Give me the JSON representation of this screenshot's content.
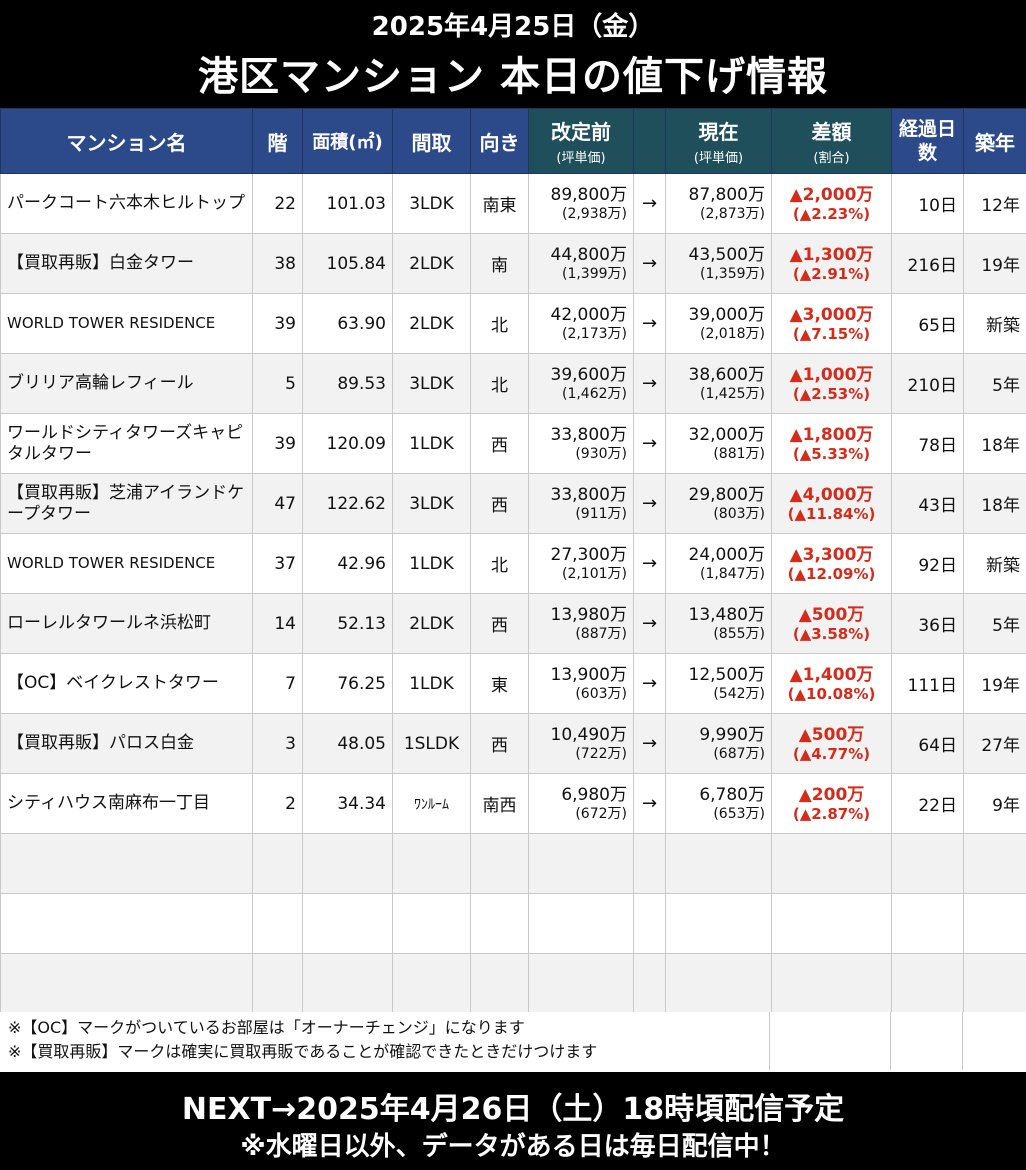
{
  "header": {
    "date": "2025年4月25日（金）",
    "title": "港区マンション 本日の値下げ情報"
  },
  "columns": {
    "name": "マンション名",
    "floor": "階",
    "area": "面積(㎡)",
    "layout": "間取",
    "direction": "向き",
    "before": "改定前",
    "before_sub": "(坪単価)",
    "current": "現在",
    "current_sub": "(坪単価)",
    "diff": "差額",
    "diff_sub": "(割合)",
    "elapsed": "経過日数",
    "age": "築年"
  },
  "arrow": "→",
  "rows": [
    {
      "name": "パークコート六本木ヒルトップ",
      "floor": "22",
      "area": "101.03",
      "layout": "3LDK",
      "direction": "南東",
      "before": "89,800万",
      "before_tsubo": "(2,938万)",
      "current": "87,800万",
      "current_tsubo": "(2,873万)",
      "diff": "▲2,000万",
      "diff_pct": "(▲2.23%)",
      "elapsed": "10日",
      "age": "12年"
    },
    {
      "name": "【買取再販】白金タワー",
      "floor": "38",
      "area": "105.84",
      "layout": "2LDK",
      "direction": "南",
      "before": "44,800万",
      "before_tsubo": "(1,399万)",
      "current": "43,500万",
      "current_tsubo": "(1,359万)",
      "diff": "▲1,300万",
      "diff_pct": "(▲2.91%)",
      "elapsed": "216日",
      "age": "19年"
    },
    {
      "name": "WORLD TOWER RESIDENCE",
      "floor": "39",
      "area": "63.90",
      "layout": "2LDK",
      "direction": "北",
      "before": "42,000万",
      "before_tsubo": "(2,173万)",
      "current": "39,000万",
      "current_tsubo": "(2,018万)",
      "diff": "▲3,000万",
      "diff_pct": "(▲7.15%)",
      "elapsed": "65日",
      "age": "新築"
    },
    {
      "name": "ブリリア高輪レフィール",
      "floor": "5",
      "area": "89.53",
      "layout": "3LDK",
      "direction": "北",
      "before": "39,600万",
      "before_tsubo": "(1,462万)",
      "current": "38,600万",
      "current_tsubo": "(1,425万)",
      "diff": "▲1,000万",
      "diff_pct": "(▲2.53%)",
      "elapsed": "210日",
      "age": "5年"
    },
    {
      "name": "ワールドシティタワーズキャピタルタワー",
      "floor": "39",
      "area": "120.09",
      "layout": "1LDK",
      "direction": "西",
      "before": "33,800万",
      "before_tsubo": "(930万)",
      "current": "32,000万",
      "current_tsubo": "(881万)",
      "diff": "▲1,800万",
      "diff_pct": "(▲5.33%)",
      "elapsed": "78日",
      "age": "18年"
    },
    {
      "name": "【買取再販】芝浦アイランドケープタワー",
      "floor": "47",
      "area": "122.62",
      "layout": "3LDK",
      "direction": "西",
      "before": "33,800万",
      "before_tsubo": "(911万)",
      "current": "29,800万",
      "current_tsubo": "(803万)",
      "diff": "▲4,000万",
      "diff_pct": "(▲11.84%)",
      "elapsed": "43日",
      "age": "18年"
    },
    {
      "name": "WORLD TOWER RESIDENCE",
      "floor": "37",
      "area": "42.96",
      "layout": "1LDK",
      "direction": "北",
      "before": "27,300万",
      "before_tsubo": "(2,101万)",
      "current": "24,000万",
      "current_tsubo": "(1,847万)",
      "diff": "▲3,300万",
      "diff_pct": "(▲12.09%)",
      "elapsed": "92日",
      "age": "新築"
    },
    {
      "name": "ローレルタワールネ浜松町",
      "floor": "14",
      "area": "52.13",
      "layout": "2LDK",
      "direction": "西",
      "before": "13,980万",
      "before_tsubo": "(887万)",
      "current": "13,480万",
      "current_tsubo": "(855万)",
      "diff": "▲500万",
      "diff_pct": "(▲3.58%)",
      "elapsed": "36日",
      "age": "5年"
    },
    {
      "name": "【OC】ベイクレストタワー",
      "floor": "7",
      "area": "76.25",
      "layout": "1LDK",
      "direction": "東",
      "before": "13,900万",
      "before_tsubo": "(603万)",
      "current": "12,500万",
      "current_tsubo": "(542万)",
      "diff": "▲1,400万",
      "diff_pct": "(▲10.08%)",
      "elapsed": "111日",
      "age": "19年"
    },
    {
      "name": "【買取再販】パロス白金",
      "floor": "3",
      "area": "48.05",
      "layout": "1SLDK",
      "direction": "西",
      "before": "10,490万",
      "before_tsubo": "(722万)",
      "current": "9,990万",
      "current_tsubo": "(687万)",
      "diff": "▲500万",
      "diff_pct": "(▲4.77%)",
      "elapsed": "64日",
      "age": "27年"
    },
    {
      "name": "シティハウス南麻布一丁目",
      "floor": "2",
      "area": "34.34",
      "layout": "ﾜﾝﾙｰﾑ",
      "direction": "南西",
      "before": "6,980万",
      "before_tsubo": "(672万)",
      "current": "6,780万",
      "current_tsubo": "(653万)",
      "diff": "▲200万",
      "diff_pct": "(▲2.87%)",
      "elapsed": "22日",
      "age": "9年"
    }
  ],
  "notes": [
    "※【OC】マークがついているお部屋は「オーナーチェンジ」になります",
    "※【買取再販】マークは確実に買取再販であることが確認できたときだけつけます"
  ],
  "footer": {
    "next": "NEXT→2025年4月26日（土）18時頃配信予定",
    "sub": "※水曜日以外、データがある日は毎日配信中！"
  },
  "colors": {
    "header_blue": "#2c4a8a",
    "header_teal": "#1f4f5a",
    "diff_red": "#d62a1a"
  }
}
